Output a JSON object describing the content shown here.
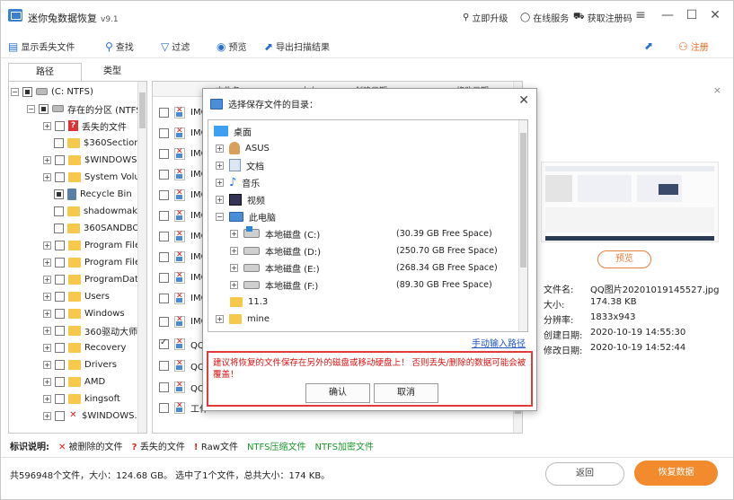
{
  "app": {
    "title": "迷你兔数据恢复",
    "version": "v9.1",
    "upgrade": "立即升级",
    "online_service": "在线服务",
    "get_code": "获取注册码"
  },
  "toolbar": {
    "show_lost": "显示丢失文件",
    "find": "查找",
    "filter": "过滤",
    "preview": "预览",
    "export": "导出扫描结果",
    "register": "注册"
  },
  "tabs": {
    "path": "路径",
    "type": "类型"
  },
  "tree": {
    "root": "(C: NTFS)",
    "partition": "存在的分区 (NTFS)",
    "items": [
      "丢失的文件",
      "$360Section",
      "$WINDOWS....",
      "System Volu...",
      "Recycle Bin",
      "shadowmak...",
      "360SANDBOX",
      "Program Files",
      "Program File...",
      "ProgramData",
      "Users",
      "Windows",
      "360驱动大师...",
      "Recovery",
      "Drivers",
      "AMD",
      "kingsoft",
      "$WINDOWS...."
    ]
  },
  "filelist": {
    "headers": [
      "文件名",
      "大小",
      "创建日期",
      "修改日期"
    ],
    "rows": [
      "IMG",
      "IMG",
      "IMG",
      "IMG",
      "IMG",
      "IMG",
      "IMG",
      "IMG",
      "IMG",
      "IMG",
      "IMG",
      "QQ图",
      "QQ图",
      "QQ图",
      "工作"
    ]
  },
  "preview": {
    "preview_btn": "预览",
    "filename_label": "文件名:",
    "filename": "QQ图片20201019145527.jpg",
    "size_label": "大小:",
    "size": "174.38 KB",
    "resolution_label": "分辨率:",
    "resolution": "1833x943",
    "created_label": "创建日期:",
    "created": "2020-10-19 14:55:30",
    "modified_label": "修改日期:",
    "modified": "2020-10-19 14:52:44"
  },
  "legend": {
    "title": "标识说明:",
    "deleted": "被删除的文件",
    "lost": "丢失的文件",
    "raw": "Raw文件",
    "ntfs_compressed": "NTFS压缩文件",
    "ntfs_encrypted": "NTFS加密文件"
  },
  "status": "共596948个文件，大小：124.68 GB。 选中了1个文件，总共大小：174 KB。",
  "buttons": {
    "back": "返回",
    "recover": "恢复数据"
  },
  "dialog": {
    "title": "选择保存文件的目录：",
    "desktop": "桌面",
    "asus": "ASUS",
    "documents": "文档",
    "music": "音乐",
    "videos": "视频",
    "this_pc": "此电脑",
    "drives": [
      {
        "name": "本地磁盘 (C:)",
        "free": "(30.39 GB Free Space)"
      },
      {
        "name": "本地磁盘 (D:)",
        "free": "(250.70 GB Free Space)"
      },
      {
        "name": "本地磁盘 (E:)",
        "free": "(268.34 GB Free Space)"
      },
      {
        "name": "本地磁盘 (F:)",
        "free": "(89.30 GB Free Space)"
      }
    ],
    "folder1": "11.3",
    "folder2": "mine",
    "manual_input": "手动输入路径",
    "warning": "建议将恢复的文件保存在另外的磁盘或移动硬盘上！ 否则丢失/删除的数据可能会被覆盖！",
    "ok": "确认",
    "cancel": "取消"
  },
  "colors": {
    "accent": "#f28a2e",
    "link": "#1f55c6",
    "warning": "#e23b3b"
  }
}
